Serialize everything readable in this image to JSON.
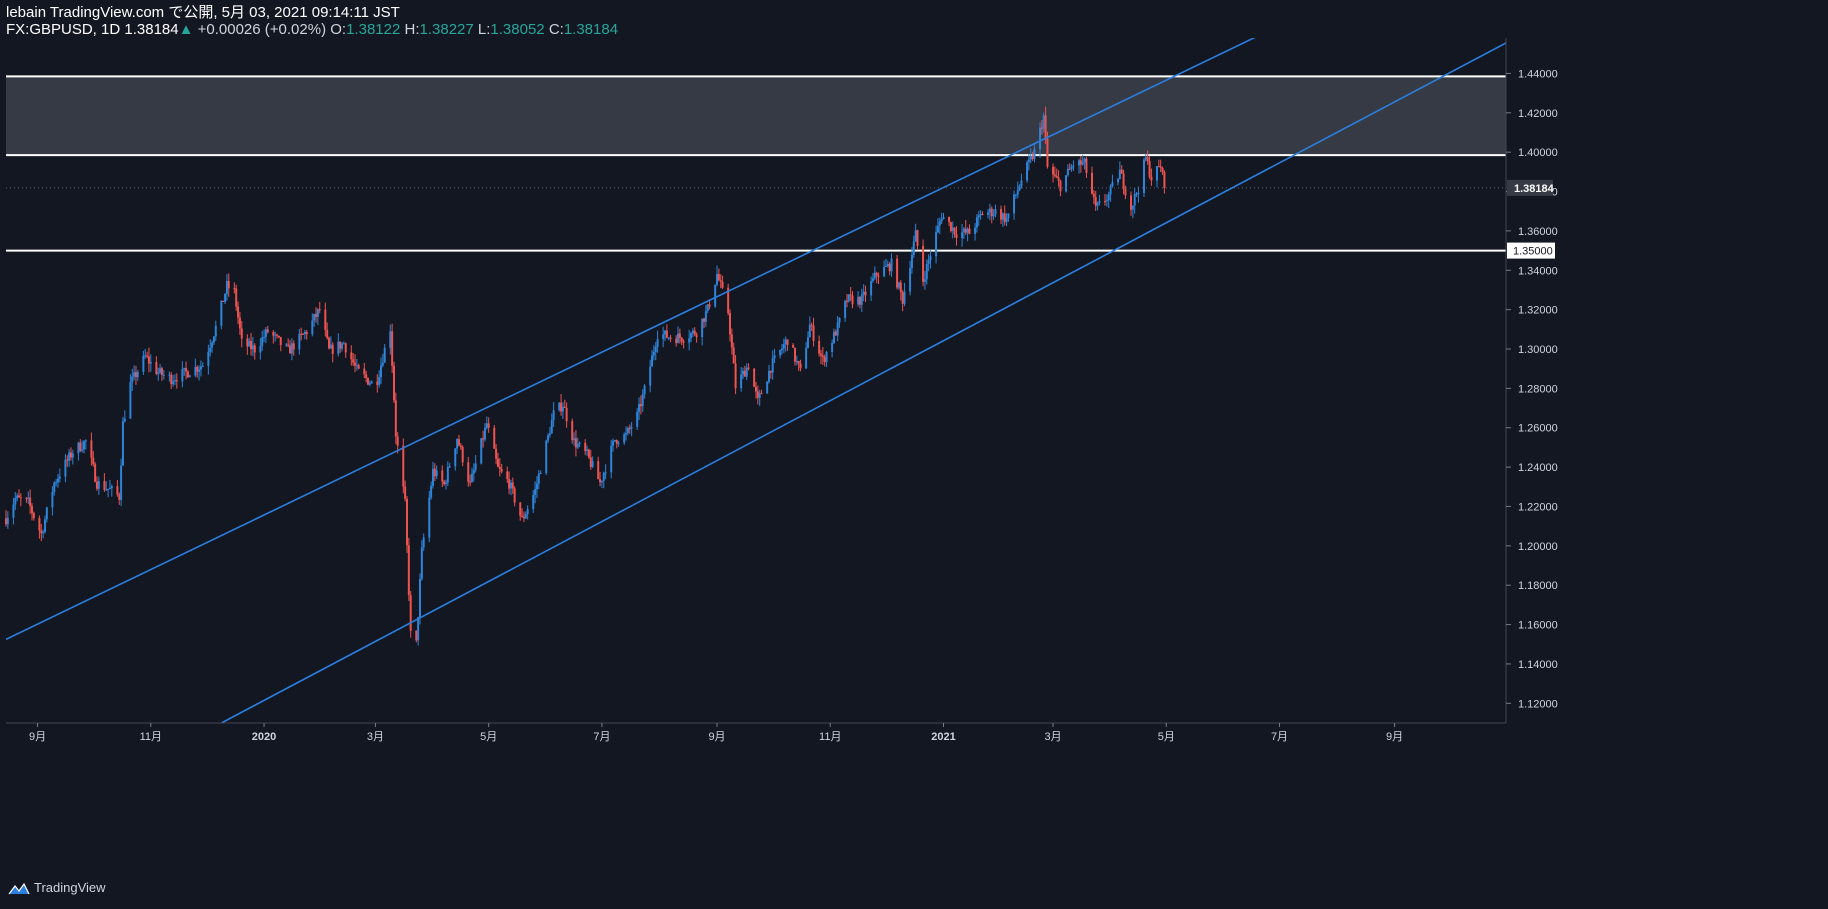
{
  "header": {
    "line1": "lebain TradingView.com で公開, 5月 03, 2021 09:14:11 JST",
    "symbol": "FX:GBPUSD, 1D",
    "last": "1.38184",
    "arrow": "▲",
    "change": "+0.00026 (+0.02%)",
    "o_label": "O:",
    "o_value": "1.38122",
    "h_label": "H:",
    "h_value": "1.38227",
    "l_label": "L:",
    "l_value": "1.38052",
    "c_label": "C:",
    "c_value": "1.38184"
  },
  "footer": {
    "brand": "TradingView",
    "brand_icon": "tradingview-logo-icon"
  },
  "colors": {
    "background": "#131722",
    "up": "#2e84d8",
    "down": "#ef5350",
    "channel": "#2a7fe0",
    "level": "#ffffff",
    "zone": "#363a45",
    "axis_text": "#d1d4dc"
  },
  "chart_data": {
    "type": "candlestick",
    "symbol": "GBPUSD",
    "interval": "1D",
    "ylim": [
      1.11,
      1.458
    ],
    "y_ticks": [
      "1.12000",
      "1.14000",
      "1.16000",
      "1.18000",
      "1.20000",
      "1.22000",
      "1.24000",
      "1.26000",
      "1.28000",
      "1.30000",
      "1.32000",
      "1.34000",
      "1.36000",
      "1.38000",
      "1.40000",
      "1.42000",
      "1.44000"
    ],
    "x_ticks": [
      {
        "label": "9月",
        "date": "2019-09-01"
      },
      {
        "label": "11月",
        "date": "2019-11-01"
      },
      {
        "label": "2020",
        "date": "2020-01-01"
      },
      {
        "label": "3月",
        "date": "2020-03-01"
      },
      {
        "label": "5月",
        "date": "2020-05-01"
      },
      {
        "label": "7月",
        "date": "2020-07-01"
      },
      {
        "label": "9月",
        "date": "2020-09-01"
      },
      {
        "label": "11月",
        "date": "2020-11-01"
      },
      {
        "label": "2021",
        "date": "2021-01-01"
      },
      {
        "label": "3月",
        "date": "2021-03-01"
      },
      {
        "label": "5月",
        "date": "2021-05-01"
      },
      {
        "label": "7月",
        "date": "2021-07-01"
      },
      {
        "label": "9月",
        "date": "2021-09-01"
      }
    ],
    "x_range": [
      "2019-08-15",
      "2021-10-31"
    ],
    "last_price": {
      "value": 1.38184,
      "label": "1.38184"
    },
    "horizontal_levels": [
      {
        "value": 1.4385
      },
      {
        "value": 1.3985
      },
      {
        "value": 1.35,
        "label": "1.35000"
      }
    ],
    "zone": {
      "from": 1.3985,
      "to": 1.4385
    },
    "channel_lines": [
      {
        "p1": {
          "date": "2019-08-15",
          "price": 1.1525
        },
        "p2": {
          "date": "2021-06-16",
          "price": 1.4575
        }
      },
      {
        "p1": {
          "date": "2019-12-15",
          "price": 1.113
        },
        "p2": {
          "date": "2021-10-31",
          "price": 1.4555
        }
      }
    ],
    "close_anchors": [
      {
        "date": "2019-08-15",
        "close": 1.214
      },
      {
        "date": "2019-08-20",
        "close": 1.224
      },
      {
        "date": "2019-08-27",
        "close": 1.222
      },
      {
        "date": "2019-09-03",
        "close": 1.206
      },
      {
        "date": "2019-09-10",
        "close": 1.232
      },
      {
        "date": "2019-09-20",
        "close": 1.248
      },
      {
        "date": "2019-09-27",
        "close": 1.253
      },
      {
        "date": "2019-10-03",
        "close": 1.232
      },
      {
        "date": "2019-10-11",
        "close": 1.228
      },
      {
        "date": "2019-10-15",
        "close": 1.225
      },
      {
        "date": "2019-10-17",
        "close": 1.262
      },
      {
        "date": "2019-10-21",
        "close": 1.282
      },
      {
        "date": "2019-10-29",
        "close": 1.296
      },
      {
        "date": "2019-11-05",
        "close": 1.288
      },
      {
        "date": "2019-11-12",
        "close": 1.285
      },
      {
        "date": "2019-11-20",
        "close": 1.288
      },
      {
        "date": "2019-11-29",
        "close": 1.292
      },
      {
        "date": "2019-12-06",
        "close": 1.311
      },
      {
        "date": "2019-12-12",
        "close": 1.332
      },
      {
        "date": "2019-12-16",
        "close": 1.329
      },
      {
        "date": "2019-12-20",
        "close": 1.303
      },
      {
        "date": "2019-12-27",
        "close": 1.3
      },
      {
        "date": "2020-01-03",
        "close": 1.309
      },
      {
        "date": "2020-01-14",
        "close": 1.299
      },
      {
        "date": "2020-01-24",
        "close": 1.309
      },
      {
        "date": "2020-01-31",
        "close": 1.32
      },
      {
        "date": "2020-02-05",
        "close": 1.299
      },
      {
        "date": "2020-02-13",
        "close": 1.303
      },
      {
        "date": "2020-02-20",
        "close": 1.289
      },
      {
        "date": "2020-03-01",
        "close": 1.281
      },
      {
        "date": "2020-03-09",
        "close": 1.311
      },
      {
        "date": "2020-03-12",
        "close": 1.257
      },
      {
        "date": "2020-03-17",
        "close": 1.221
      },
      {
        "date": "2020-03-20",
        "close": 1.155
      },
      {
        "date": "2020-03-23",
        "close": 1.15
      },
      {
        "date": "2020-03-26",
        "close": 1.197
      },
      {
        "date": "2020-04-01",
        "close": 1.238
      },
      {
        "date": "2020-04-07",
        "close": 1.231
      },
      {
        "date": "2020-04-14",
        "close": 1.255
      },
      {
        "date": "2020-04-21",
        "close": 1.231
      },
      {
        "date": "2020-04-30",
        "close": 1.262
      },
      {
        "date": "2020-05-06",
        "close": 1.239
      },
      {
        "date": "2020-05-12",
        "close": 1.232
      },
      {
        "date": "2020-05-19",
        "close": 1.213
      },
      {
        "date": "2020-05-26",
        "close": 1.228
      },
      {
        "date": "2020-06-05",
        "close": 1.267
      },
      {
        "date": "2020-06-10",
        "close": 1.272
      },
      {
        "date": "2020-06-16",
        "close": 1.253
      },
      {
        "date": "2020-06-23",
        "close": 1.246
      },
      {
        "date": "2020-06-30",
        "close": 1.232
      },
      {
        "date": "2020-07-08",
        "close": 1.254
      },
      {
        "date": "2020-07-14",
        "close": 1.256
      },
      {
        "date": "2020-07-20",
        "close": 1.266
      },
      {
        "date": "2020-07-24",
        "close": 1.279
      },
      {
        "date": "2020-07-31",
        "close": 1.308
      },
      {
        "date": "2020-08-07",
        "close": 1.306
      },
      {
        "date": "2020-08-14",
        "close": 1.306
      },
      {
        "date": "2020-08-21",
        "close": 1.309
      },
      {
        "date": "2020-08-27",
        "close": 1.32
      },
      {
        "date": "2020-09-01",
        "close": 1.338
      },
      {
        "date": "2020-09-07",
        "close": 1.319
      },
      {
        "date": "2020-09-11",
        "close": 1.281
      },
      {
        "date": "2020-09-18",
        "close": 1.292
      },
      {
        "date": "2020-09-23",
        "close": 1.273
      },
      {
        "date": "2020-09-30",
        "close": 1.291
      },
      {
        "date": "2020-10-09",
        "close": 1.305
      },
      {
        "date": "2020-10-16",
        "close": 1.288
      },
      {
        "date": "2020-10-21",
        "close": 1.312
      },
      {
        "date": "2020-10-28",
        "close": 1.294
      },
      {
        "date": "2020-11-05",
        "close": 1.311
      },
      {
        "date": "2020-11-10",
        "close": 1.325
      },
      {
        "date": "2020-11-18",
        "close": 1.325
      },
      {
        "date": "2020-11-26",
        "close": 1.338
      },
      {
        "date": "2020-12-04",
        "close": 1.343
      },
      {
        "date": "2020-12-10",
        "close": 1.325
      },
      {
        "date": "2020-12-17",
        "close": 1.358
      },
      {
        "date": "2020-12-21",
        "close": 1.335
      },
      {
        "date": "2020-12-31",
        "close": 1.368
      },
      {
        "date": "2021-01-08",
        "close": 1.359
      },
      {
        "date": "2021-01-15",
        "close": 1.359
      },
      {
        "date": "2021-01-22",
        "close": 1.369
      },
      {
        "date": "2021-01-29",
        "close": 1.37
      },
      {
        "date": "2021-02-04",
        "close": 1.366
      },
      {
        "date": "2021-02-12",
        "close": 1.386
      },
      {
        "date": "2021-02-19",
        "close": 1.4
      },
      {
        "date": "2021-02-24",
        "close": 1.418
      },
      {
        "date": "2021-02-26",
        "close": 1.392
      },
      {
        "date": "2021-03-05",
        "close": 1.383
      },
      {
        "date": "2021-03-12",
        "close": 1.394
      },
      {
        "date": "2021-03-18",
        "close": 1.394
      },
      {
        "date": "2021-03-24",
        "close": 1.371
      },
      {
        "date": "2021-03-31",
        "close": 1.378
      },
      {
        "date": "2021-04-06",
        "close": 1.39
      },
      {
        "date": "2021-04-12",
        "close": 1.372
      },
      {
        "date": "2021-04-16",
        "close": 1.382
      },
      {
        "date": "2021-04-20",
        "close": 1.397
      },
      {
        "date": "2021-04-23",
        "close": 1.387
      },
      {
        "date": "2021-04-28",
        "close": 1.393
      },
      {
        "date": "2021-04-30",
        "close": 1.3818
      }
    ]
  }
}
